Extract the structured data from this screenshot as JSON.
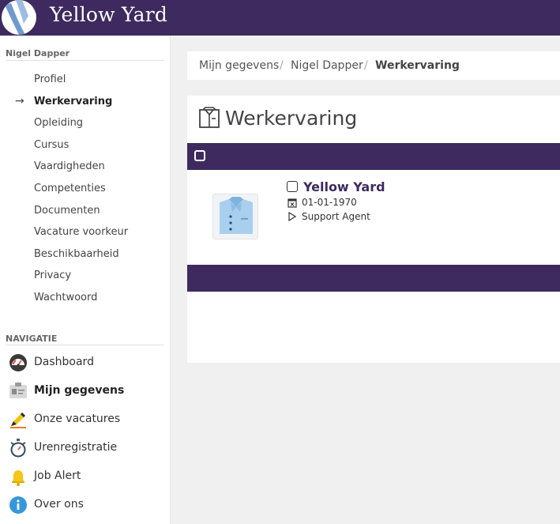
{
  "app": {
    "brand": "Yellow Yard"
  },
  "sidebar": {
    "profile_title": "Nigel Dapper",
    "profile_items": [
      {
        "label": "Profiel",
        "active": false
      },
      {
        "label": "Werkervaring",
        "active": true
      },
      {
        "label": "Opleiding",
        "active": false
      },
      {
        "label": "Cursus",
        "active": false
      },
      {
        "label": "Vaardigheden",
        "active": false
      },
      {
        "label": "Competenties",
        "active": false
      },
      {
        "label": "Documenten",
        "active": false
      },
      {
        "label": "Vacature voorkeur",
        "active": false
      },
      {
        "label": "Beschikbaarheid",
        "active": false
      },
      {
        "label": "Privacy",
        "active": false
      },
      {
        "label": "Wachtwoord",
        "active": false
      }
    ],
    "nav_title": "NAVIGATIE",
    "nav_items": [
      {
        "label": "Dashboard",
        "icon": "gauge-icon"
      },
      {
        "label": "Mijn gegevens",
        "icon": "id-card-icon"
      },
      {
        "label": "Onze vacatures",
        "icon": "pen-icon"
      },
      {
        "label": "Urenregistratie",
        "icon": "stopwatch-icon"
      },
      {
        "label": "Job Alert",
        "icon": "bell-icon"
      },
      {
        "label": "Over ons",
        "icon": "info-icon"
      }
    ]
  },
  "breadcrumb": [
    "Mijn gegevens",
    "Nigel Dapper",
    "Werkervaring"
  ],
  "main": {
    "title": "Werkervaring",
    "entries": [
      {
        "company": "Yellow Yard",
        "date": "01-01-1970",
        "role": "Support Agent"
      }
    ]
  },
  "colors": {
    "primary": "#3e2a5f",
    "accent": "#4a90c8"
  }
}
